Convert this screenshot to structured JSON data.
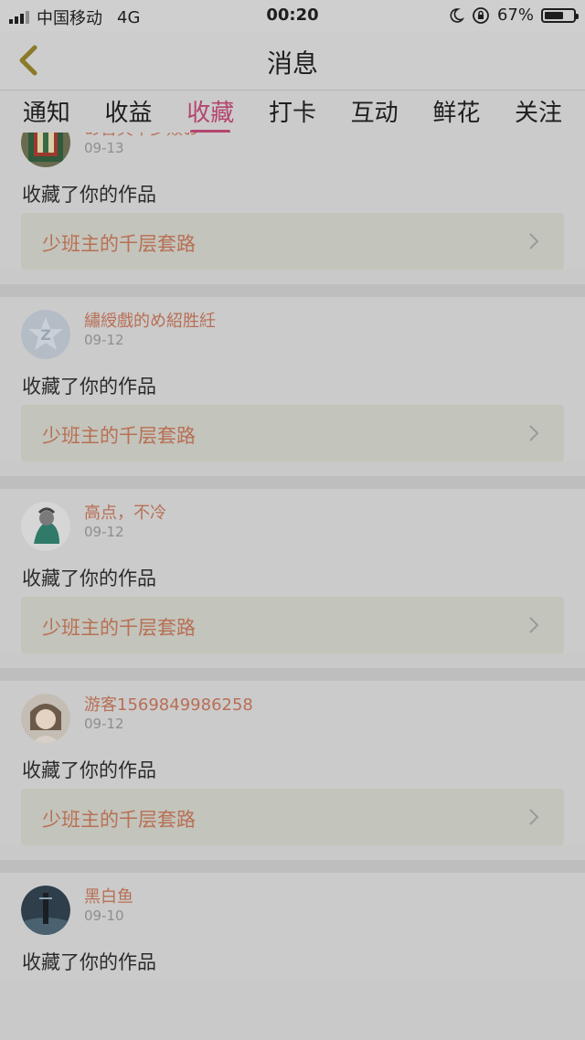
{
  "status_bar": {
    "carrier": "中国移动",
    "network": "4G",
    "time": "00:20",
    "battery_percent": "67%",
    "battery_level": 0.67
  },
  "header": {
    "title": "消息",
    "back_icon": "chevron-left-icon"
  },
  "tabs": [
    {
      "label": "通知",
      "active": false
    },
    {
      "label": "收益",
      "active": false
    },
    {
      "label": "收藏",
      "active": true
    },
    {
      "label": "打卡",
      "active": false
    },
    {
      "label": "互动",
      "active": false
    },
    {
      "label": "鲜花",
      "active": false
    },
    {
      "label": "关注",
      "active": false
    }
  ],
  "colors": {
    "accent": "#b4456f",
    "link": "#b86f55",
    "overlay_dim": "#cbcbcb"
  },
  "notifications": [
    {
      "user": "あ含笑半步颠お",
      "date": "09-13",
      "action": "收藏了你的作品",
      "work": "少班主的千层套路"
    },
    {
      "user": "繡綬戲的め紹胜紝",
      "date": "09-12",
      "action": "收藏了你的作品",
      "work": "少班主的千层套路"
    },
    {
      "user": "高点，不冷",
      "date": "09-12",
      "action": "收藏了你的作品",
      "work": "少班主的千层套路"
    },
    {
      "user": "游客1569849986258",
      "date": "09-12",
      "action": "收藏了你的作品",
      "work": "少班主的千层套路"
    },
    {
      "user": "黑白鱼",
      "date": "09-10",
      "action": "收藏了你的作品",
      "work": ""
    }
  ]
}
